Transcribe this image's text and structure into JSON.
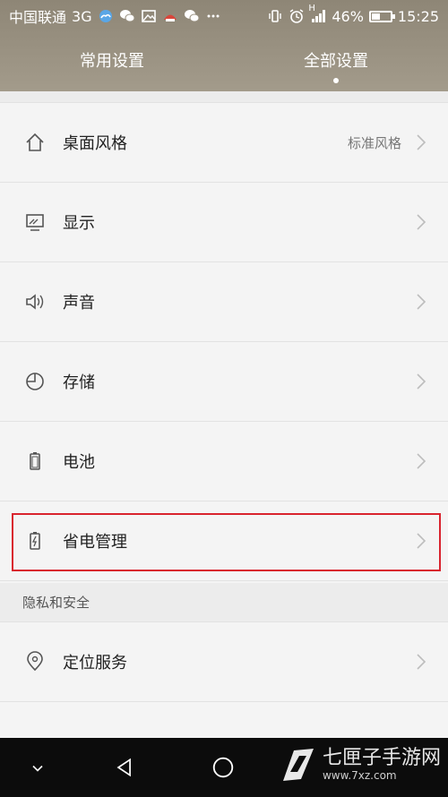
{
  "status_bar": {
    "carrier": "中国联通",
    "network": "3G",
    "signal_label": "H",
    "battery_percent": "46%",
    "battery_level": 0.46,
    "time": "15:25"
  },
  "tabs": [
    {
      "label": "常用设置",
      "active": false
    },
    {
      "label": "全部设置",
      "active": true
    }
  ],
  "settings": [
    {
      "label": "桌面风格",
      "value": "标准风格",
      "icon": "home-icon"
    },
    {
      "label": "显示",
      "value": "",
      "icon": "display-icon"
    },
    {
      "label": "声音",
      "value": "",
      "icon": "speaker-icon"
    },
    {
      "label": "存储",
      "value": "",
      "icon": "storage-icon"
    },
    {
      "label": "电池",
      "value": "",
      "icon": "battery-icon"
    },
    {
      "label": "省电管理",
      "value": "",
      "icon": "power-saving-icon"
    }
  ],
  "section": {
    "title": "隐私和安全",
    "items": [
      {
        "label": "定位服务",
        "icon": "location-icon"
      }
    ]
  },
  "highlight_color": "#d9232e",
  "watermark": {
    "name": "七匣子手游网",
    "url": "www.7xz.com"
  }
}
